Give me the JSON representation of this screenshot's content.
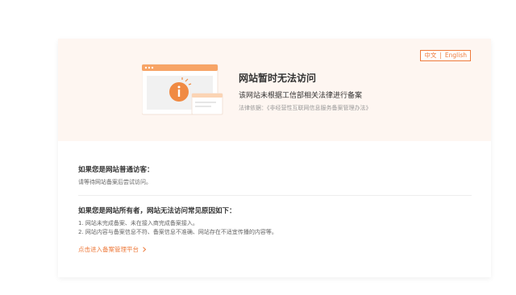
{
  "lang": {
    "zh": "中文",
    "separator": "|",
    "en": "English"
  },
  "hero": {
    "title": "网站暂时无法访问",
    "subtitle": "该网站未根据工信部相关法律进行备案",
    "law": "法律依据：《非经营性互联网信息服务备案管理办法》",
    "illustration_icon": "info-icon"
  },
  "visitor": {
    "title": "如果您是网站普通访客：",
    "text": "请等待网站备案后尝试访问。"
  },
  "owner": {
    "title": "如果您是网站所有者，网站无法访问常见原因如下：",
    "reasons": [
      "1. 网站未完成备案、未在接入商完成备案接入。",
      "2. 网站内容与备案信息不符、备案信息不准确、网站存在不适宜传播的内容等。"
    ]
  },
  "link": {
    "label": "点击进入备案管理平台",
    "icon": "chevron-right-icon"
  },
  "colors": {
    "accent": "#ee7a3b",
    "hero_bg": "#fef6f1"
  }
}
